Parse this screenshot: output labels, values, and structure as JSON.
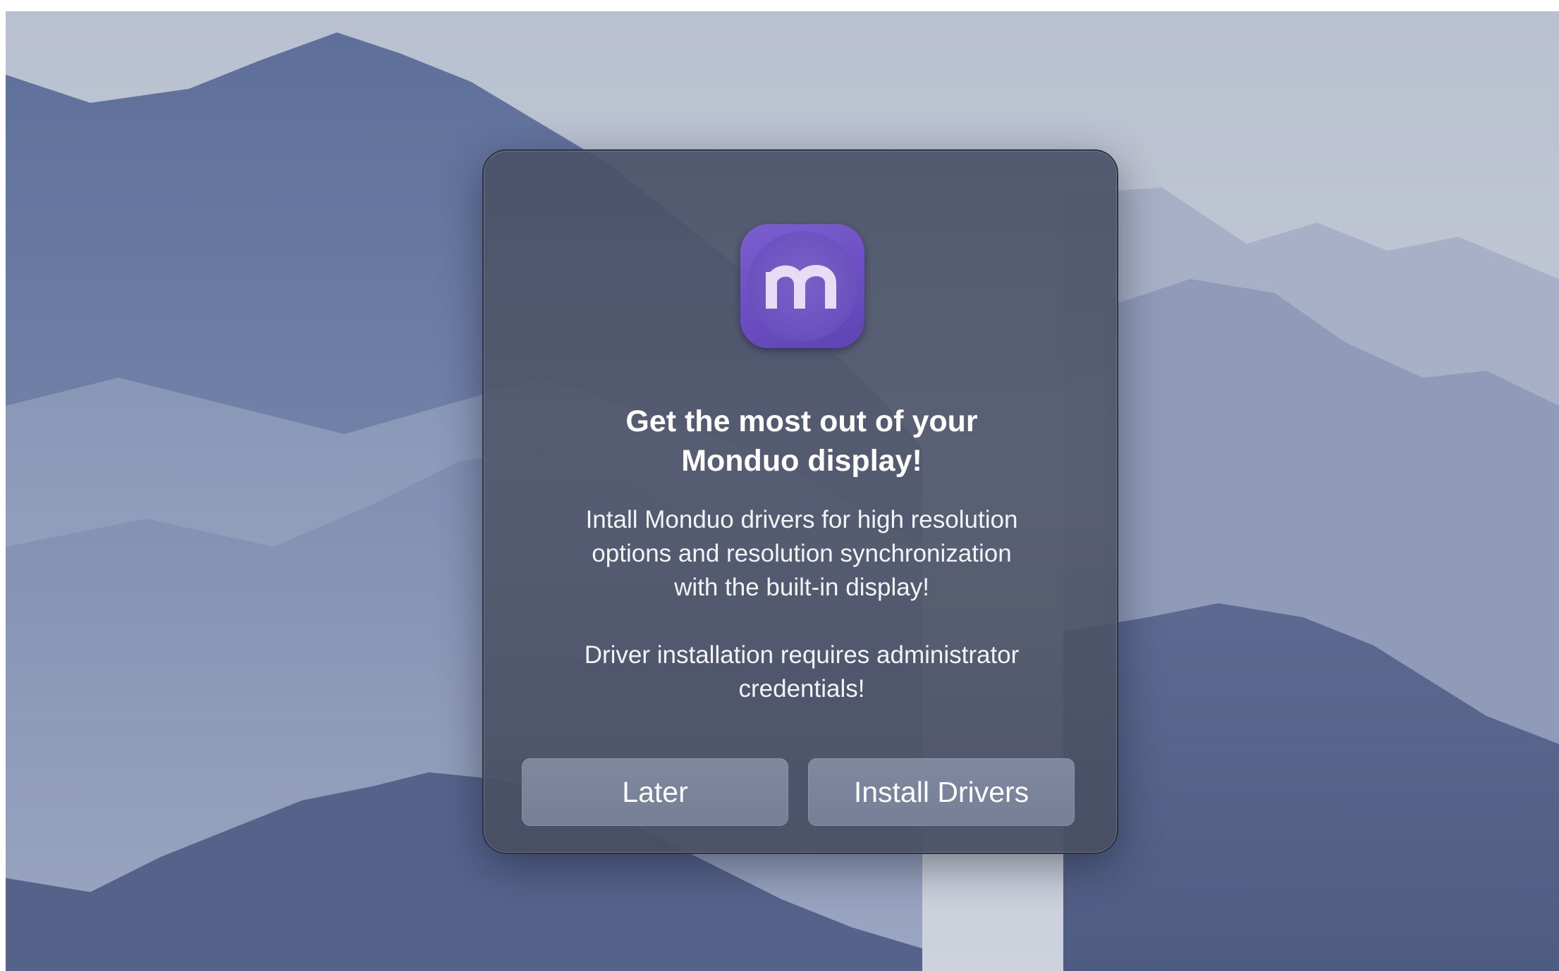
{
  "app": {
    "icon_name": "monduo-app-icon",
    "icon_letter": "m",
    "accent_color": "#6b4fc2"
  },
  "dialog": {
    "title_line1": "Get the most out of your",
    "title_line2": "Monduo display!",
    "message_line1": "Intall Monduo drivers for high resolution",
    "message_line2": "options and resolution synchronization",
    "message_line3": "with the built-in display!",
    "note_line1": "Driver installation requires administrator",
    "note_line2": "credentials!"
  },
  "buttons": {
    "later_label": "Later",
    "install_label": "Install Drivers"
  }
}
